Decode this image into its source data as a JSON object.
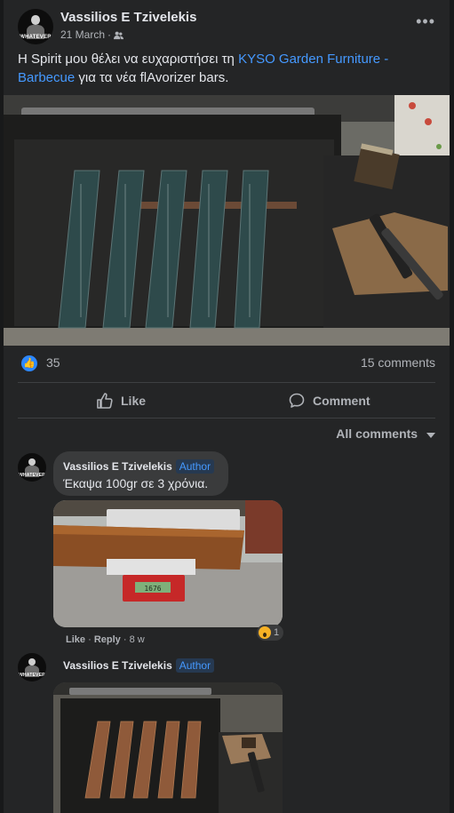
{
  "post": {
    "author": "Vassilios E Tzivelekis",
    "avatar_text": "WHATEVER",
    "date": "21 March",
    "audience_icon": "friends-icon",
    "text_before": "Η Spirit μου θέλει να ευχαριστήσει τη ",
    "link_text": "KYSO Garden Furniture - Barbecue",
    "text_after": " για τα νέα flAvorizer bars.",
    "reactions_count": "35",
    "comments_count": "15 comments",
    "like_label": "Like",
    "comment_label": "Comment",
    "sort_label": "All comments"
  },
  "comments": [
    {
      "author": "Vassilios E Tzivelekis",
      "badge": "Author",
      "text": "Έκαψα 100gr σε 3 χρόνια.",
      "like_label": "Like",
      "reply_label": "Reply",
      "time": "8 w",
      "reaction_count": "1",
      "reaction_icon": "wow-icon",
      "scale_display": "1676"
    },
    {
      "author": "Vassilios E Tzivelekis",
      "badge": "Author"
    }
  ],
  "colors": {
    "background": "#242526",
    "link": "#4599ff",
    "like_blue": "#2d88ff",
    "bar_teal": "#2e4a4b",
    "rust": "#8a4e24"
  }
}
